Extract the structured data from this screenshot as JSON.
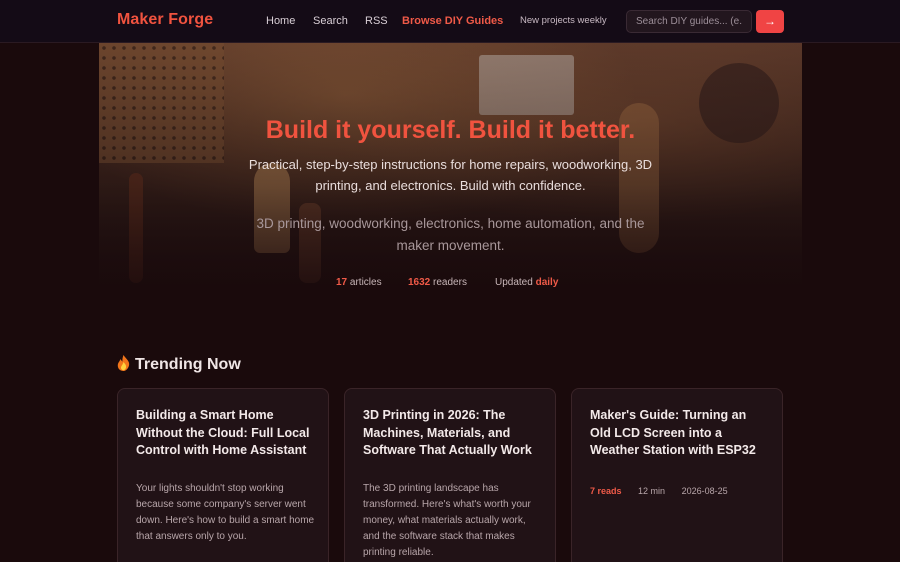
{
  "nav": {
    "brand": "Maker Forge",
    "links": [
      "Home",
      "Search",
      "RSS",
      "Browse DIY Guides"
    ],
    "tagline": "New projects weekly",
    "search_placeholder": "Search DIY guides... (e.",
    "search_button": "→"
  },
  "hero": {
    "title": "Build it yourself. Build it better.",
    "subtitle": "Practical, step-by-step instructions for home repairs, woodworking, 3D printing, and electronics. Build with confidence.",
    "topics": "3D printing, woodworking, electronics, home automation, and the maker movement.",
    "stats": {
      "articles_count": "17",
      "articles_label": "articles",
      "readers_count": "1632",
      "readers_label": "readers",
      "updated_label": "Updated",
      "updated_value": "daily"
    }
  },
  "trending": {
    "icon": "fire-icon",
    "title": "Trending Now",
    "cards": [
      {
        "title": "Building a Smart Home Without the Cloud: Full Local Control with Home Assistant",
        "excerpt": "Your lights shouldn't stop working because some company's server went down. Here's how to build a smart home that answers only to you."
      },
      {
        "title": "3D Printing in 2026: The Machines, Materials, and Software That Actually Work",
        "excerpt": "The 3D printing landscape has transformed. Here's what's worth your money, what materials actually work, and the software stack that makes printing reliable."
      },
      {
        "title": "Maker's Guide: Turning an Old LCD Screen into a Weather Station with ESP32",
        "reads": "7 reads",
        "time": "12 min",
        "date": "2026-08-25"
      }
    ]
  },
  "colors": {
    "accent": "#f0533f",
    "background": "#1a0a0c",
    "nav_bg": "#140b16",
    "card_bg": "#211216"
  }
}
